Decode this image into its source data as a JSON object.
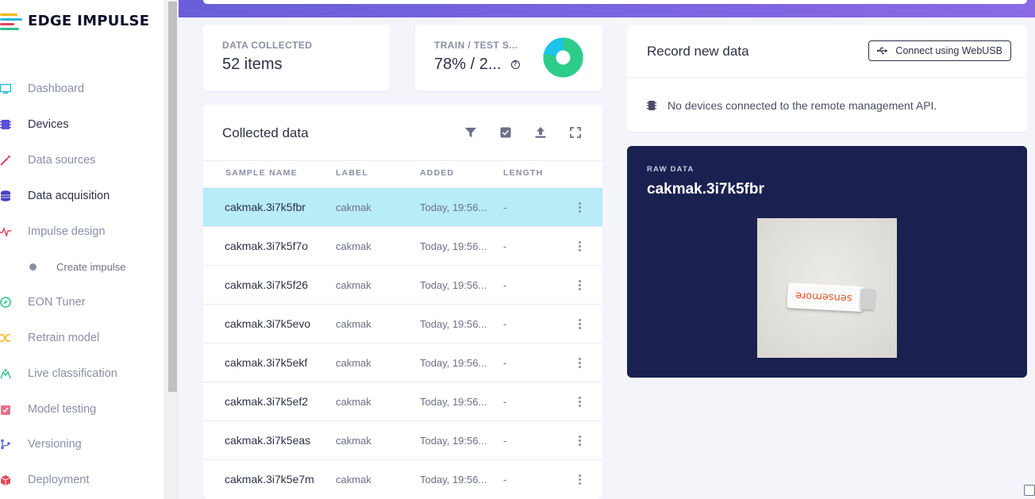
{
  "brand": {
    "name": "EDGE IMPULSE"
  },
  "sidebar": {
    "items": [
      {
        "label": "Dashboard",
        "icon": "monitor-icon",
        "color": "#29b6d6"
      },
      {
        "label": "Devices",
        "icon": "chip-icon",
        "color": "#5b4fd6"
      },
      {
        "label": "Data sources",
        "icon": "wand-icon",
        "color": "#e2455a"
      },
      {
        "label": "Data acquisition",
        "icon": "database-icon",
        "color": "#4b3fc4"
      },
      {
        "label": "Impulse design",
        "icon": "pulse-icon",
        "color": "#e2455a"
      },
      {
        "label": "Create impulse",
        "icon": "dot-icon",
        "color": "#8a8fa6"
      },
      {
        "label": "EON Tuner",
        "icon": "compass-icon",
        "color": "#2ec28a"
      },
      {
        "label": "Retrain model",
        "icon": "shuffle-icon",
        "color": "#f2b61c"
      },
      {
        "label": "Live classification",
        "icon": "robot-icon",
        "color": "#2ec28a"
      },
      {
        "label": "Model testing",
        "icon": "clipboard-check-icon",
        "color": "#e86f8a"
      },
      {
        "label": "Versioning",
        "icon": "git-branch-icon",
        "color": "#5b6bd6"
      },
      {
        "label": "Deployment",
        "icon": "box-icon",
        "color": "#e2455a"
      }
    ]
  },
  "stats": {
    "collected_label": "DATA COLLECTED",
    "collected_value": "52 items",
    "split_label": "TRAIN / TEST S...",
    "split_value": "78% / 2...",
    "split_train_fraction": 0.78
  },
  "collected": {
    "title": "Collected data",
    "columns": [
      "SAMPLE NAME",
      "LABEL",
      "ADDED",
      "LENGTH"
    ],
    "rows": [
      {
        "name": "cakmak.3i7k5fbr",
        "label": "cakmak",
        "added": "Today, 19:56...",
        "length": "-"
      },
      {
        "name": "cakmak.3i7k5f7o",
        "label": "cakmak",
        "added": "Today, 19:56...",
        "length": "-"
      },
      {
        "name": "cakmak.3i7k5f26",
        "label": "cakmak",
        "added": "Today, 19:56...",
        "length": "-"
      },
      {
        "name": "cakmak.3i7k5evo",
        "label": "cakmak",
        "added": "Today, 19:56...",
        "length": "-"
      },
      {
        "name": "cakmak.3i7k5ekf",
        "label": "cakmak",
        "added": "Today, 19:56...",
        "length": "-"
      },
      {
        "name": "cakmak.3i7k5ef2",
        "label": "cakmak",
        "added": "Today, 19:56...",
        "length": "-"
      },
      {
        "name": "cakmak.3i7k5eas",
        "label": "cakmak",
        "added": "Today, 19:56...",
        "length": "-"
      },
      {
        "name": "cakmak.3i7k5e7m",
        "label": "cakmak",
        "added": "Today, 19:56...",
        "length": "-"
      }
    ]
  },
  "record": {
    "title": "Record new data",
    "connect_label": "Connect using WebUSB",
    "no_devices": "No devices connected to the remote management API."
  },
  "raw": {
    "label": "RAW DATA",
    "title": "cakmak.3i7k5fbr",
    "photo_text": "sensemore"
  },
  "colors": {
    "accent": "#6a5fd9",
    "selected_row": "#b8ecf7",
    "train": "#2ecc8a",
    "test": "#1ec3ea",
    "raw_bg": "#1a2150"
  }
}
